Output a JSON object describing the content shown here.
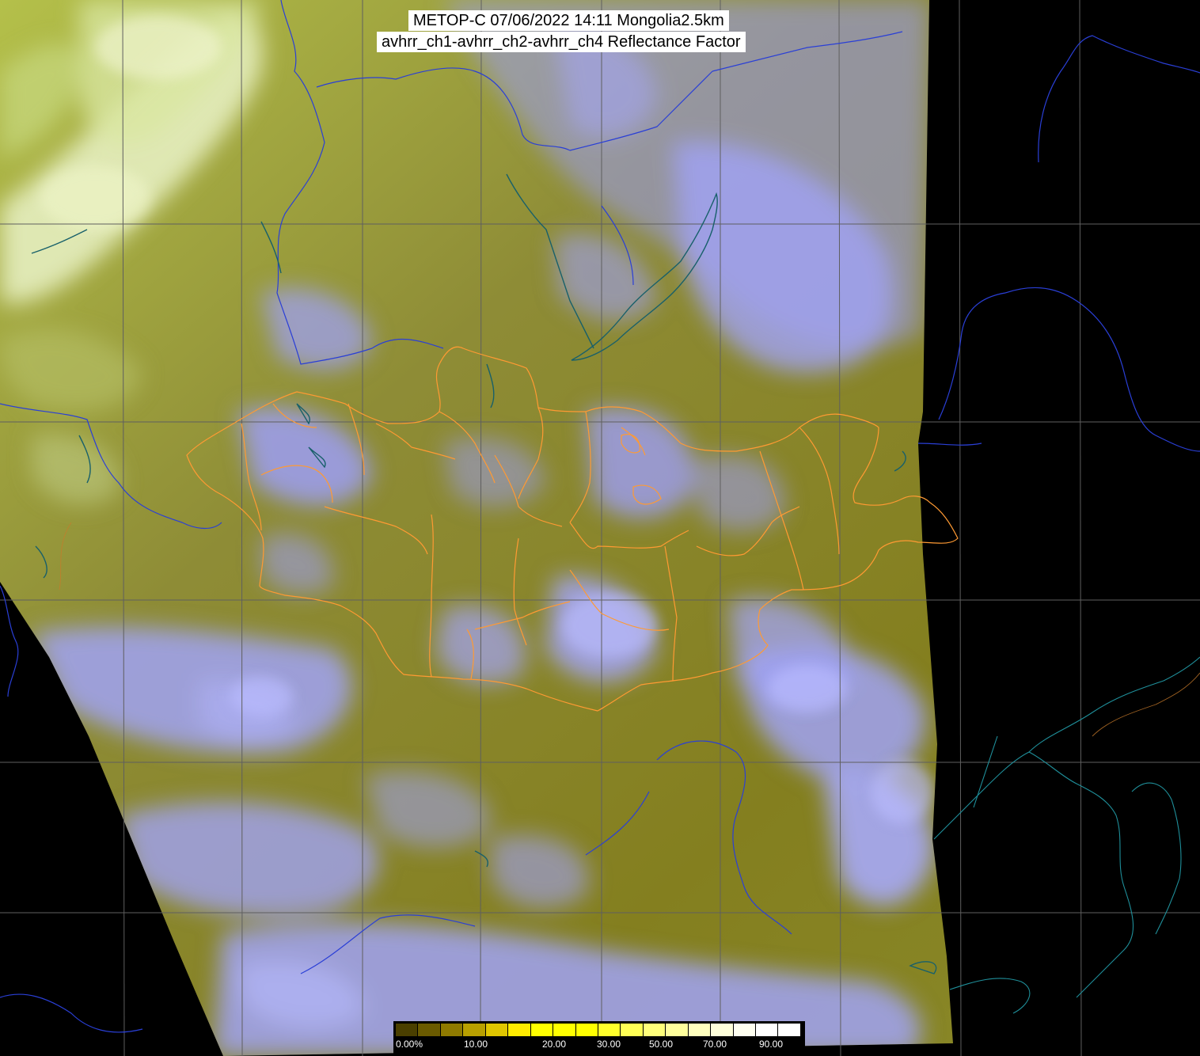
{
  "title": {
    "line1": "METOP-C 07/06/2022 14:11 Mongolia2.5km",
    "line2": "avhrr_ch1-avhrr_ch2-avhrr_ch4 Reflectance Factor"
  },
  "colorbar": {
    "labels": [
      "0.00%",
      "10.00",
      "20.00",
      "30.00",
      "50.00",
      "70.00",
      "90.00"
    ],
    "colors": [
      "#4a3f00",
      "#6a5a00",
      "#8f7a00",
      "#b9a000",
      "#e0c600",
      "#ffeb00",
      "#ffff00",
      "#ffff00",
      "#ffff00",
      "#ffff2b",
      "#ffff55",
      "#ffff7a",
      "#ffff9c",
      "#ffffbd",
      "#ffffda",
      "#fffff0",
      "#ffffff",
      "#ffffff"
    ]
  },
  "map": {
    "background": "#000000",
    "swath_base": "#8a8a2a",
    "cloud_color": "#9a9cf4",
    "bright_cloud": "#e6f0b0",
    "grid_color": "#5f5f5f",
    "coast_color": "#2a3fd6",
    "border_color": "#ff9a33",
    "lake_color": "#18606a",
    "korea_coast_color": "#1f8f9a"
  }
}
